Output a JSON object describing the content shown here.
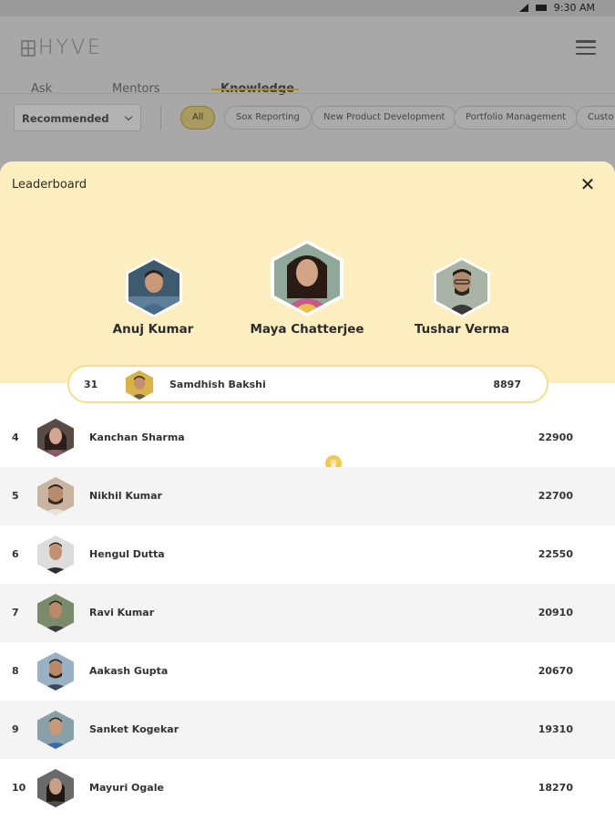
{
  "status_bar": {
    "time": "9:30 AM"
  },
  "app": {
    "logo_text": "HYVE"
  },
  "tabs": [
    {
      "label": "Ask"
    },
    {
      "label": "Mentors"
    },
    {
      "label": "Knowledge",
      "active": true
    }
  ],
  "filters": {
    "sort_selected": "Recommended",
    "chips": [
      {
        "label": "All",
        "active": true
      },
      {
        "label": "Sox Reporting"
      },
      {
        "label": "New Product Development"
      },
      {
        "label": "Portfolio Management"
      },
      {
        "label": "Custo"
      }
    ]
  },
  "leaderboard": {
    "title": "Leaderboard",
    "top_three": [
      {
        "name": "Anuj Kumar"
      },
      {
        "name": "Maya Chatterjee",
        "crown": true
      },
      {
        "name": "Tushar Verma"
      }
    ],
    "current_user": {
      "rank": "31",
      "name": "Samdhish Bakshi",
      "score": "8897"
    },
    "entries": [
      {
        "rank": "4",
        "name": "Kanchan Sharma",
        "score": "22900"
      },
      {
        "rank": "5",
        "name": "Nikhil Kumar",
        "score": "22700"
      },
      {
        "rank": "6",
        "name": "Hengul Dutta",
        "score": "22550"
      },
      {
        "rank": "7",
        "name": "Ravi Kumar",
        "score": "20910"
      },
      {
        "rank": "8",
        "name": "Aakash Gupta",
        "score": "20670"
      },
      {
        "rank": "9",
        "name": "Sanket Kogekar",
        "score": "19310"
      },
      {
        "rank": "10",
        "name": "Mayuri Ogale",
        "score": "18270"
      }
    ]
  },
  "colors": {
    "header_bg": "#fdeec0",
    "accent": "#f2c94c",
    "overlay": "#a8a8a8"
  }
}
